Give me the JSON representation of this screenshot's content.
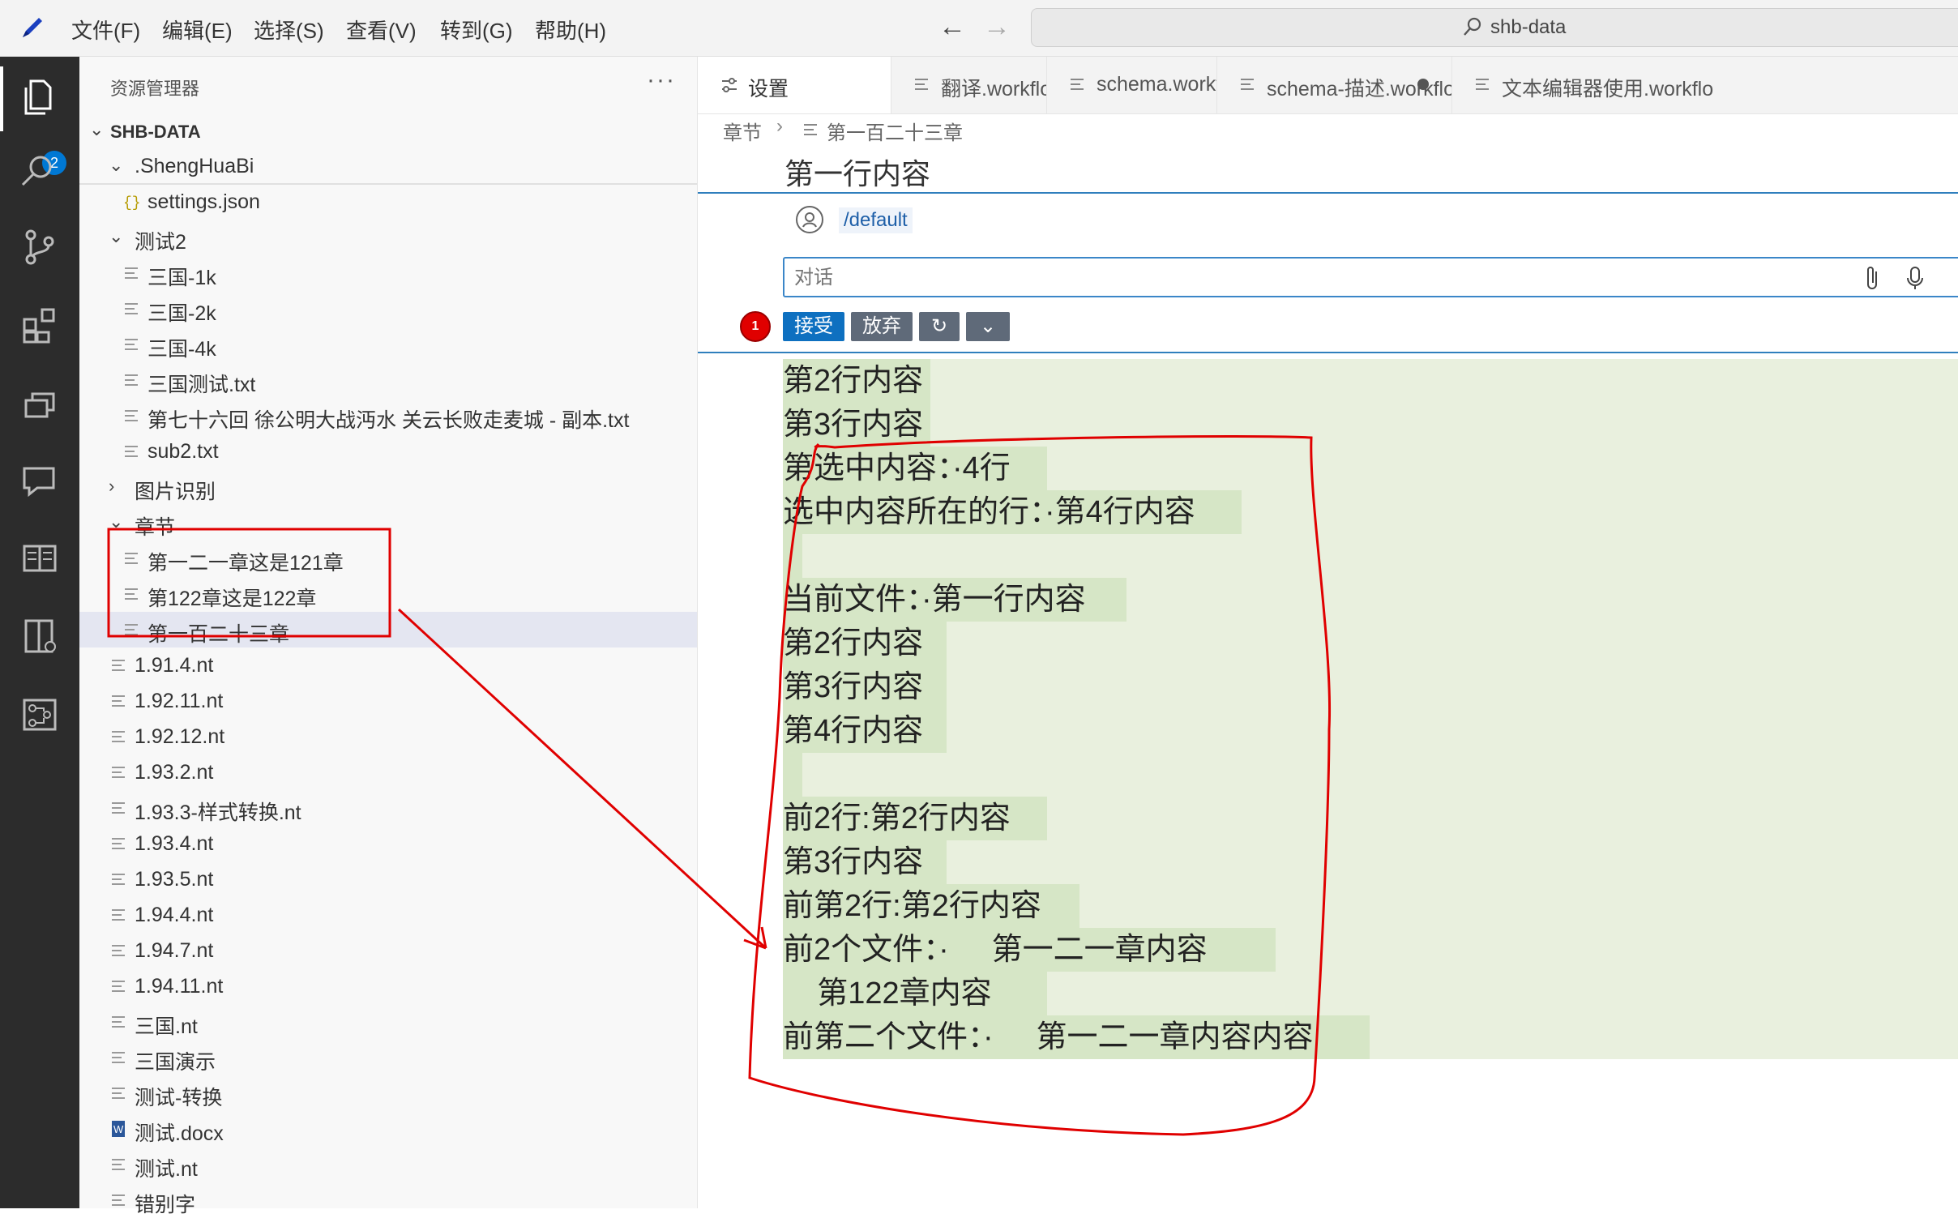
{
  "titlebar": {
    "menu": [
      "文件(F)",
      "编辑(E)",
      "选择(S)",
      "查看(V)",
      "转到(G)",
      "帮助(H)"
    ],
    "search_text": "shb-data"
  },
  "activity": {
    "icons": [
      "files-icon",
      "search-icon",
      "source-control-icon",
      "extensions-icon",
      "remote-icon",
      "chat-icon",
      "book-icon",
      "panel-icon",
      "workflow-icon"
    ],
    "explorer_badge": "2"
  },
  "sidebar": {
    "title": "资源管理器",
    "more": "···",
    "root": "SHB-DATA",
    "items": [
      {
        "label": ".ShengHuaBi",
        "kind": "folder",
        "expanded": true,
        "depth": 1
      },
      {
        "label": "settings.json",
        "kind": "json",
        "depth": 2
      },
      {
        "label": "测试2",
        "kind": "folder",
        "expanded": true,
        "depth": 1
      },
      {
        "label": "三国-1k",
        "kind": "file",
        "depth": 2
      },
      {
        "label": "三国-2k",
        "kind": "file",
        "depth": 2
      },
      {
        "label": "三国-4k",
        "kind": "file",
        "depth": 2
      },
      {
        "label": "三国测试.txt",
        "kind": "file",
        "depth": 2
      },
      {
        "label": "第七十六回 徐公明大战沔水 关云长败走麦城 - 副本.txt",
        "kind": "file",
        "depth": 2
      },
      {
        "label": "sub2.txt",
        "kind": "file",
        "depth": 2
      },
      {
        "label": "图片识别",
        "kind": "folder",
        "expanded": false,
        "depth": 1
      },
      {
        "label": "章节",
        "kind": "folder",
        "expanded": true,
        "depth": 1
      },
      {
        "label": "第一二一章这是121章",
        "kind": "file",
        "depth": 2
      },
      {
        "label": "第122章这是122章",
        "kind": "file",
        "depth": 2
      },
      {
        "label": "第一百二十三章",
        "kind": "file",
        "depth": 2,
        "selected": true
      },
      {
        "label": "1.91.4.nt",
        "kind": "file",
        "depth": 1
      },
      {
        "label": "1.92.11.nt",
        "kind": "file",
        "depth": 1
      },
      {
        "label": "1.92.12.nt",
        "kind": "file",
        "depth": 1
      },
      {
        "label": "1.93.2.nt",
        "kind": "file",
        "depth": 1
      },
      {
        "label": "1.93.3-样式转换.nt",
        "kind": "file",
        "depth": 1
      },
      {
        "label": "1.93.4.nt",
        "kind": "file",
        "depth": 1
      },
      {
        "label": "1.93.5.nt",
        "kind": "file",
        "depth": 1
      },
      {
        "label": "1.94.4.nt",
        "kind": "file",
        "depth": 1
      },
      {
        "label": "1.94.7.nt",
        "kind": "file",
        "depth": 1
      },
      {
        "label": "1.94.11.nt",
        "kind": "file",
        "depth": 1
      },
      {
        "label": "三国.nt",
        "kind": "file",
        "depth": 1
      },
      {
        "label": "三国演示",
        "kind": "file",
        "depth": 1
      },
      {
        "label": "测试-转换",
        "kind": "file",
        "depth": 1
      },
      {
        "label": "测试.docx",
        "kind": "word",
        "depth": 1
      },
      {
        "label": "测试.nt",
        "kind": "file",
        "depth": 1
      },
      {
        "label": "错别字",
        "kind": "file",
        "depth": 1
      }
    ]
  },
  "tabs": [
    {
      "label": "设置",
      "icon": "settings-icon",
      "active": true
    },
    {
      "label": "翻译.workflow",
      "icon": "file-icon"
    },
    {
      "label": "schema.workflow",
      "icon": "file-icon"
    },
    {
      "label": "schema-描述.workflow",
      "icon": "file-icon",
      "dirty": true
    },
    {
      "label": "文本编辑器使用.workflo",
      "icon": "file-icon"
    }
  ],
  "breadcrumb": {
    "folder": "章节",
    "file": "第一百二十三章"
  },
  "editor": {
    "line1": "第一行内容",
    "agent_path": "/default",
    "chat_placeholder": "对话",
    "badge": "1",
    "buttons": {
      "accept": "接受",
      "discard": "放弃",
      "refresh": "↻",
      "more": "⌄"
    },
    "diff_lines": [
      "第2行内容",
      "第3行内容",
      "第选中内容：·4行",
      "选中内容所在的行：·第4行内容",
      "",
      "当前文件：·第一行内容",
      "第2行内容",
      "第3行内容",
      "第4行内容",
      "",
      "前2行:第2行内容",
      "第3行内容",
      "前第2行:第2行内容",
      "前2个文件：·     第一二一章内容",
      "    第122章内容",
      "前第二个文件：·     第一二一章内容内容"
    ]
  },
  "colors": {
    "accent": "#0e70c0",
    "annotation": "#e00000",
    "diff_bg": "#e9f0de",
    "diff_line": "#d6e6c6"
  }
}
